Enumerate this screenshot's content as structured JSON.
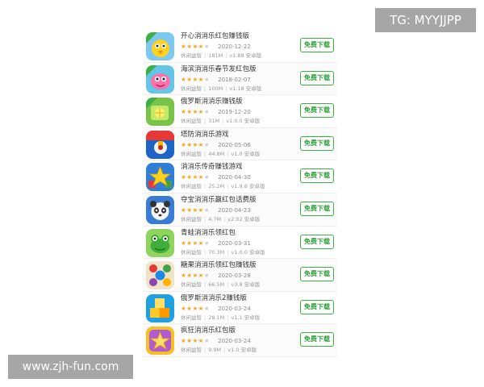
{
  "watermarks": {
    "top_right": "TG: MYYJJPP",
    "bottom_left": "www.zjh-fun.com"
  },
  "colors": {
    "accent_green": "#3cb043",
    "star": "#f5a623"
  },
  "download_label": "免费下载",
  "apps": [
    {
      "title": "开心消消乐红包赚钱版",
      "rating": 4,
      "date": "2020-12-22",
      "category": "休闲益智",
      "size": "181M",
      "version": "v1.88 安卓版",
      "icon": "yellow-chick-icon",
      "ribbon": true
    },
    {
      "title": "海滨消消乐春节发红包版",
      "rating": 4,
      "date": "2018-02-07",
      "category": "休闲益智",
      "size": "100M",
      "version": "v1.18 安卓版",
      "icon": "pink-monster-icon",
      "ribbon": true
    },
    {
      "title": "俄罗斯消消乐赚钱版",
      "rating": 4,
      "date": "2019-12-20",
      "category": "休闲益智",
      "size": "31M",
      "version": "v1.0.0 安卓版",
      "icon": "green-fruit-block-icon",
      "ribbon": true
    },
    {
      "title": "塔防消消乐游戏",
      "rating": 4,
      "date": "2020-05-06",
      "category": "休闲益智",
      "size": "44.8M",
      "version": "v1.0 安卓版",
      "icon": "red-blue-tank-icon",
      "ribbon": false
    },
    {
      "title": "消消乐传奇赚钱游戏",
      "rating": 4,
      "date": "2020-04-30",
      "category": "休闲益智",
      "size": "25.2M",
      "version": "v1.9.8 安卓版",
      "icon": "yellow-star-blocks-icon",
      "ribbon": false
    },
    {
      "title": "夺宝消消乐赢红包话费版",
      "rating": 4,
      "date": "2020-04-23",
      "category": "休闲益智",
      "size": "4.7M",
      "version": "v2.02 安卓版",
      "icon": "panda-icon",
      "ribbon": false
    },
    {
      "title": "青蛙消消乐领红包",
      "rating": 4,
      "date": "2020-03-31",
      "category": "休闲益智",
      "size": "70.3M",
      "version": "v1.0.0 安卓版",
      "icon": "green-frog-icon",
      "ribbon": false
    },
    {
      "title": "糖果消消乐领红包赚钱版",
      "rating": 4,
      "date": "2020-03-28",
      "category": "休闲益智",
      "size": "66.5M",
      "version": "v3.8 安卓版",
      "icon": "candy-icon",
      "ribbon": false
    },
    {
      "title": "俄罗斯消消乐2赚钱版",
      "rating": 4,
      "date": "2020-03-24",
      "category": "休闲益智",
      "size": "28.1M",
      "version": "v1.1 安卓版",
      "icon": "cube-blocks-icon",
      "ribbon": false
    },
    {
      "title": "疯狂消消乐红包版",
      "rating": 4,
      "date": "2020-03-24",
      "category": "休闲益智",
      "size": "9.9M",
      "version": "v1.0 安卓版",
      "icon": "purple-star-icon",
      "ribbon": false
    }
  ]
}
